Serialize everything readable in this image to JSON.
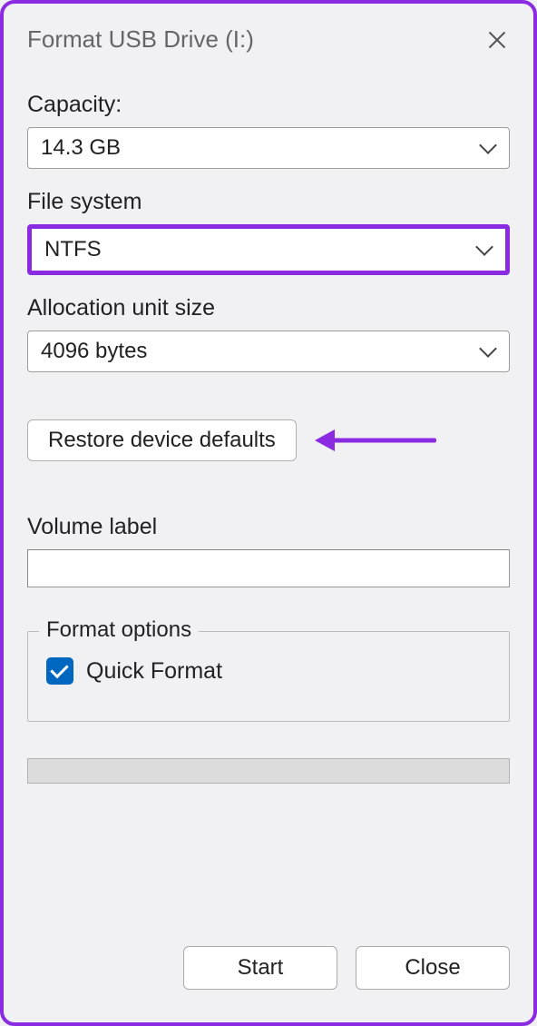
{
  "dialog": {
    "title": "Format USB Drive (I:)"
  },
  "capacity": {
    "label": "Capacity:",
    "value": "14.3 GB"
  },
  "filesystem": {
    "label": "File system",
    "value": "NTFS"
  },
  "allocation": {
    "label": "Allocation unit size",
    "value": "4096 bytes"
  },
  "restore": {
    "label": "Restore device defaults"
  },
  "volume": {
    "label": "Volume label",
    "value": ""
  },
  "format_options": {
    "legend": "Format options",
    "quick_format": {
      "label": "Quick Format",
      "checked": true
    }
  },
  "buttons": {
    "start": "Start",
    "close": "Close"
  },
  "annotation": {
    "highlight_color": "#8a2be2"
  }
}
